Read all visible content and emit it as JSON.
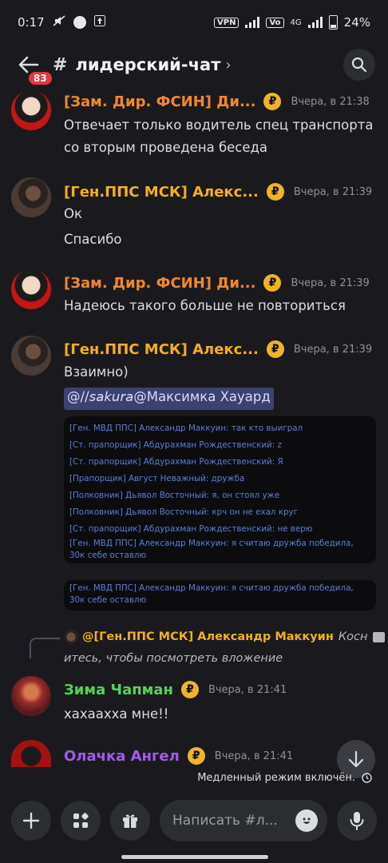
{
  "status_bar": {
    "time": "0:17",
    "vpn": "VPN",
    "network": "4G",
    "battery": "24%"
  },
  "header": {
    "badge": "83",
    "hash": "#",
    "channel": "лидерский-чат",
    "chevron": "›"
  },
  "messages": [
    {
      "author": "[Зам. Дир. ФСИН] Ди...",
      "time": "Вчера, в 21:38",
      "lines": [
        "Отвечает только водитель спец транспорта",
        "со вторым проведена беседа"
      ]
    },
    {
      "author": "[Ген.ППС МСК] Алекс...",
      "time": "Вчера, в 21:39",
      "lines": [
        "Ок",
        "Спасибо"
      ]
    },
    {
      "author": "[Зам. Дир. ФСИН] Ди...",
      "time": "Вчера, в 21:39",
      "lines": [
        "Надеюсь такого больше не повториться"
      ]
    },
    {
      "author": "[Ген.ППС МСК] Алекс...",
      "time": "Вчера, в 21:39",
      "lines": [
        "Взаимно)"
      ],
      "mention": "@//𝘴𝘢𝘬𝘶𝘳𝘢@Максимка Хауард"
    },
    {
      "author": "Зима Чапман",
      "time": "Вчера, в 21:41",
      "lines": [
        "хахаахха мне!!"
      ]
    },
    {
      "author": "Олачка Ангел",
      "time": "Вчера, в 21:41",
      "lines": []
    }
  ],
  "log_image_1": [
    "[Ген. МВД ППС] Александр Маккуин: так кто выиграл",
    "[Ст. прапорщик] Абдурахман Рождественский: z",
    "[Ст. прапорщик] Абдурахман Рождественский: Я",
    "[Прапорщик] Август Неважный: дружба",
    "[Полковник] Дьявол Восточный: я, он стоял уже",
    "[Полковник] Дьявол Восточный: крч он не ехал круг",
    "[Ст. прапорщик] Абдурахман Рождественский: не верю",
    "[Ген. МВД ППС] Александр Маккуин: я считаю дружба победила, 30к себе оставлю"
  ],
  "log_image_2": "[Ген. МВД ППС] Александр Маккуин: я считаю дружба победила, 30к себе оставлю",
  "reply": {
    "name": "@[Ген.ППС МСК] Александр Маккуин",
    "text_a": "Косн",
    "text_b": "итесь, чтобы посмотреть вложение"
  },
  "currency_symbol": "₽",
  "slow_mode": "Медленный режим включён.",
  "composer": {
    "placeholder": "Написать #л..."
  },
  "colors": {
    "background": "#1a1a1e",
    "orange_role": "#f0882c",
    "gold_role": "#f2b01d",
    "green_role": "#54d25a",
    "purple_role": "#a45be8",
    "badge_red": "#e5383f"
  }
}
